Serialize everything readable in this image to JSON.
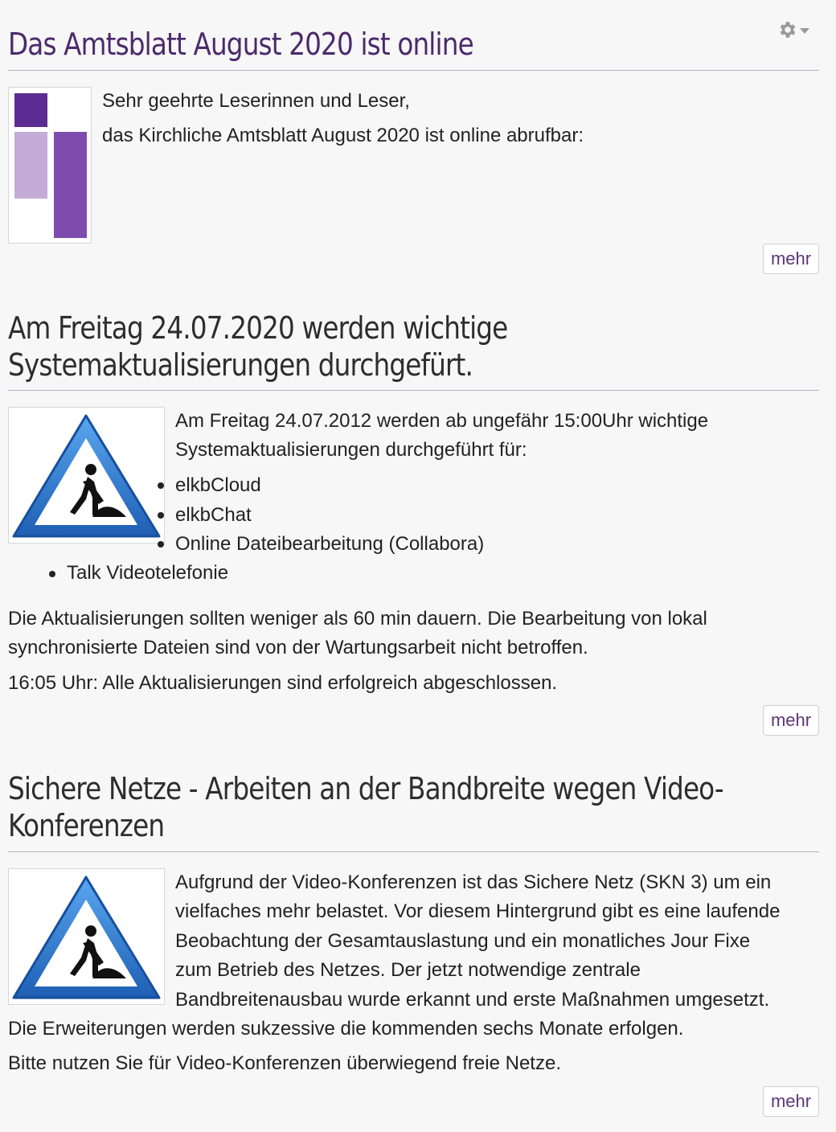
{
  "gear": {
    "icon": "gear-icon",
    "caret": "chevron-down-icon"
  },
  "articles": [
    {
      "title": "Das Amtsblatt August 2020 ist online",
      "greeting": "Sehr geehrte Leserinnen und Leser,",
      "body": "das Kirchliche Amtsblatt August 2020 ist online abrufbar:",
      "more_label": "mehr",
      "logo_colors": [
        "#5b2c91",
        "#c4acd9",
        "#7e4cad"
      ]
    },
    {
      "title_line1": "Am Freitag 24.07.2020 werden wichtige",
      "title_line2": "Systemaktualisierungen durchgefürt.",
      "intro_line1": "Am Freitag 24.07.2012 werden ab ungefähr 15:00Uhr wichtige",
      "intro_line2": "Systemaktualisierungen durchgeführt für:",
      "list": [
        "elkbCloud",
        "elkbChat",
        "Online Dateibearbeitung (Collabora)",
        "Talk Videotelefonie"
      ],
      "para1_line1": "Die Aktualisierungen sollten weniger als 60 min dauern. Die Bearbeitung von lokal",
      "para1_line2": "synchronisierte Dateien sind von der Wartungsarbeit nicht betroffen.",
      "para2": "16:05 Uhr: Alle Aktualisierungen sind erfolgreich abgeschlossen.",
      "more_label": "mehr"
    },
    {
      "title_line1": "Sichere Netze - Arbeiten an der Bandbreite wegen Video-",
      "title_line2": "Konferenzen",
      "lines": [
        "Aufgrund der Video-Konferenzen ist das Sichere Netz (SKN 3) um ein",
        "vielfaches mehr belastet. Vor diesem Hintergrund gibt es eine laufende",
        "Beobachtung der Gesamtauslastung und ein monatliches Jour Fixe",
        "zum Betrieb des Netzes. Der jetzt notwendige zentrale",
        "Bandbreitenausbau wurde erkannt und erste Maßnahmen umgesetzt.",
        "Die Erweiterungen werden sukzessive die kommenden sechs Monate erfolgen."
      ],
      "last_para": "Bitte nutzen Sie für Video-Konferenzen überwiegend freie Netze.",
      "more_label": "mehr"
    }
  ],
  "colors": {
    "title_purple": "#4b2a6b",
    "link": "#5d3577",
    "sign_blue": "#2f7dd1"
  }
}
